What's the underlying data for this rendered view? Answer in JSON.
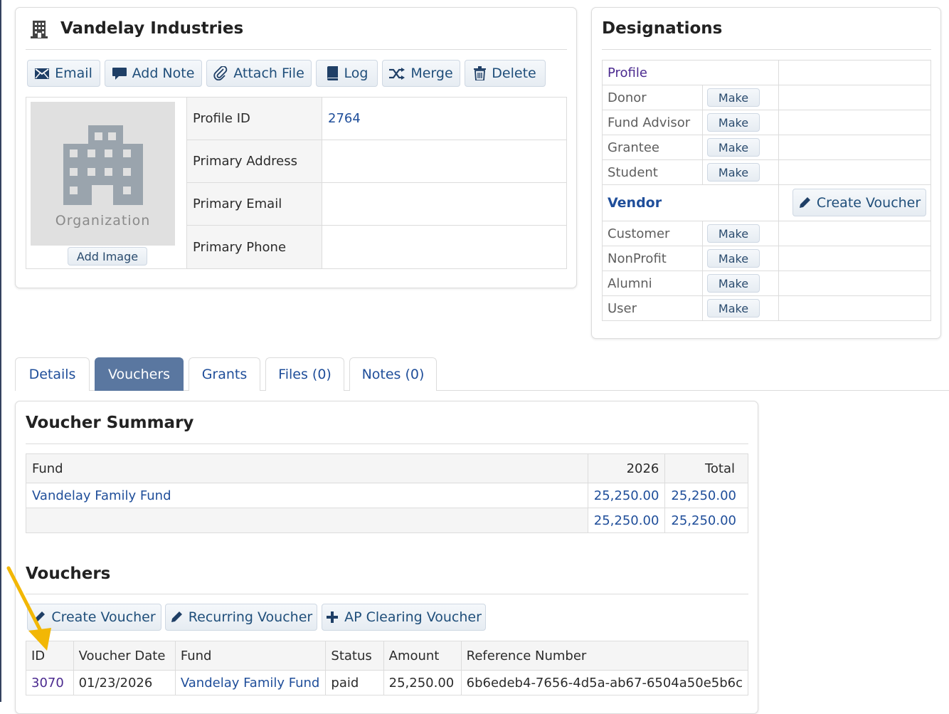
{
  "organization": {
    "name": "Vandelay Industries",
    "actions": [
      "Email",
      "Add Note",
      "Attach File",
      "Log",
      "Merge",
      "Delete"
    ],
    "placeholder_label": "Organization",
    "add_image_label": "Add Image",
    "fields": [
      {
        "label": "Profile ID",
        "value": "2764"
      },
      {
        "label": "Primary Address",
        "value": ""
      },
      {
        "label": "Primary Email",
        "value": ""
      },
      {
        "label": "Primary Phone",
        "value": ""
      }
    ]
  },
  "designations": {
    "title": "Designations",
    "profile_label": "Profile",
    "make_label": "Make",
    "items": [
      "Donor",
      "Fund Advisor",
      "Grantee",
      "Student"
    ],
    "active": {
      "label": "Vendor",
      "action": "Create Voucher"
    },
    "items_after": [
      "Customer",
      "NonProfit",
      "Alumni",
      "User"
    ]
  },
  "tabs": [
    "Details",
    "Vouchers",
    "Grants",
    "Files (0)",
    "Notes (0)"
  ],
  "active_tab": "Vouchers",
  "voucher_summary": {
    "title": "Voucher Summary",
    "headers": [
      "Fund",
      "2026",
      "Total"
    ],
    "rows": [
      {
        "fund": "Vandelay Family Fund",
        "year": "25,250.00",
        "total": "25,250.00"
      }
    ],
    "totals": {
      "year": "25,250.00",
      "total": "25,250.00"
    }
  },
  "vouchers": {
    "title": "Vouchers",
    "actions": [
      "Create Voucher",
      "Recurring Voucher",
      "AP Clearing Voucher"
    ],
    "headers": [
      "ID",
      "Voucher Date",
      "Fund",
      "Status",
      "Amount",
      "Reference Number"
    ],
    "rows": [
      {
        "id": "3070",
        "date": "01/23/2026",
        "fund": "Vandelay Family Fund",
        "status": "paid",
        "amount": "25,250.00",
        "reference": "6b6edeb4-7656-4d5a-ab67-6504a50e5b6c"
      }
    ]
  },
  "colors": {
    "link": "#1f4e9a",
    "active_tab": "#5a77a0",
    "annotation_arrow": "#f2b705"
  }
}
